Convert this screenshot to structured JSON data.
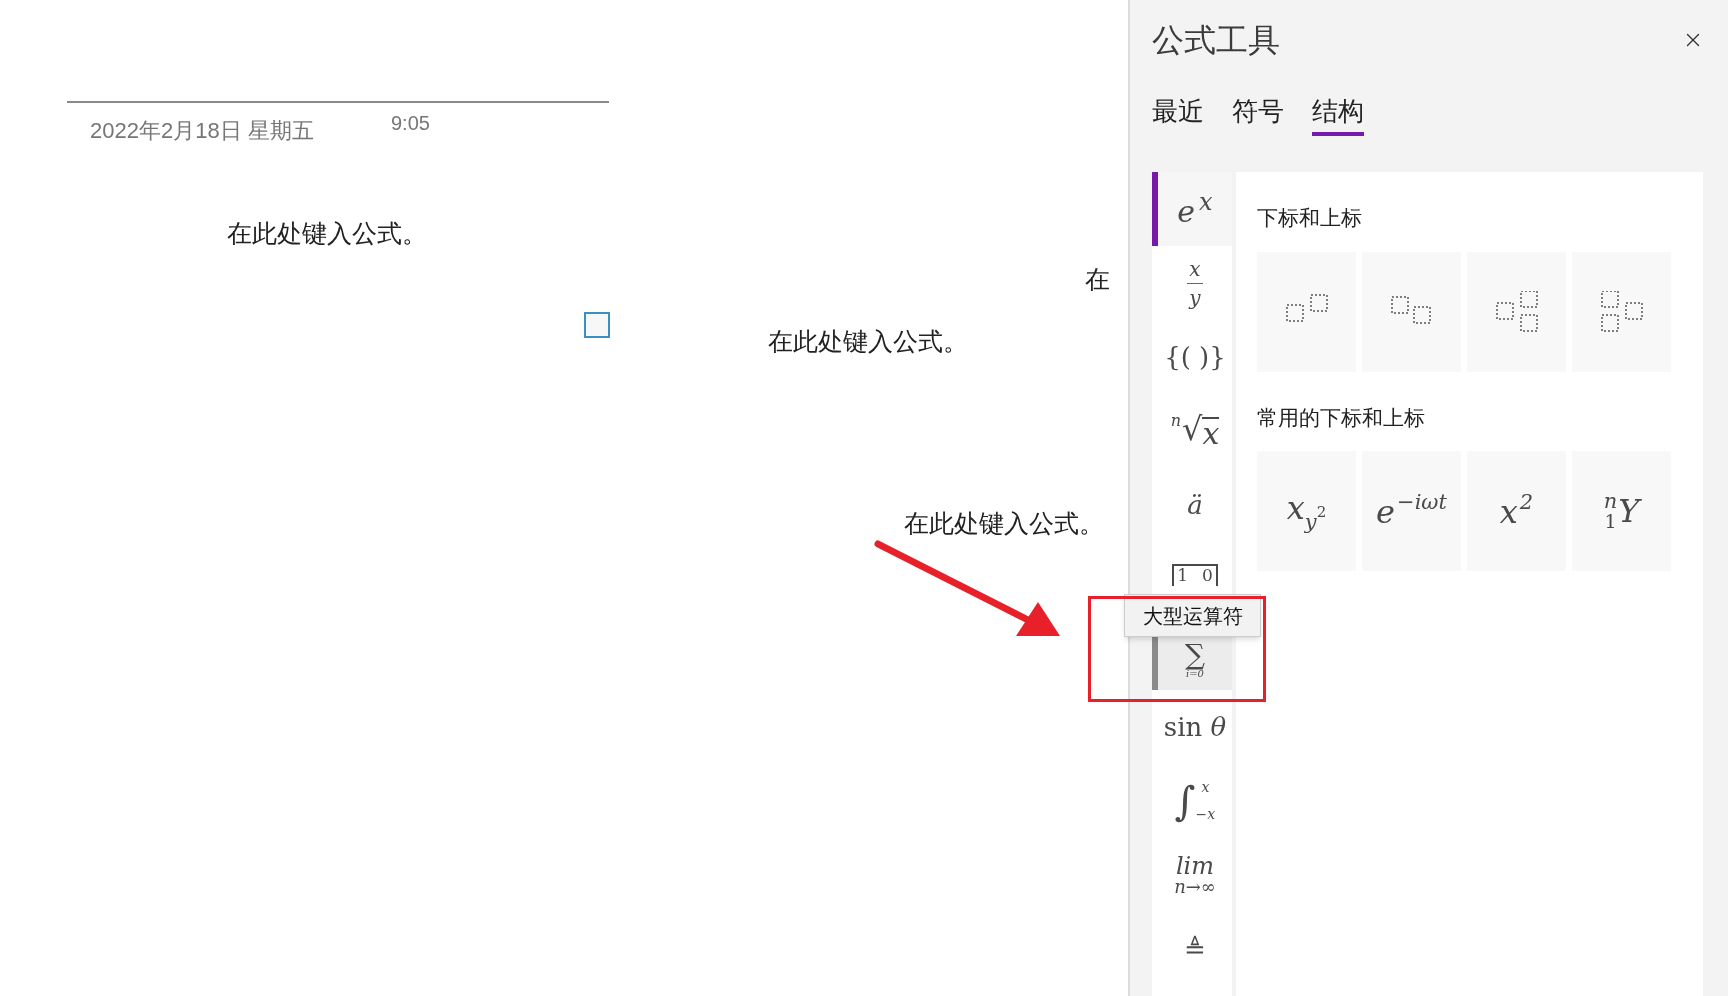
{
  "page": {
    "date": "2022年2月18日 星期五",
    "time": "9:05",
    "equations": [
      {
        "text": "在此处键入公式。"
      },
      {
        "text": "在"
      },
      {
        "text": "在此处键入公式。"
      },
      {
        "text": "在此处键入公式。"
      }
    ]
  },
  "panel": {
    "title": "公式工具",
    "tabs": [
      {
        "label": "最近",
        "selected": false
      },
      {
        "label": "符号",
        "selected": false
      },
      {
        "label": "结构",
        "selected": true
      }
    ],
    "categories": [
      {
        "kind": "script",
        "base": "e",
        "sup": "x",
        "selected": true,
        "hovered": false
      },
      {
        "kind": "fraction",
        "num": "x",
        "den": "y",
        "selected": false,
        "hovered": false
      },
      {
        "kind": "text",
        "text": "{( )}",
        "selected": false,
        "hovered": false
      },
      {
        "kind": "radical",
        "index": "n",
        "symbol": "√",
        "radicand": "x",
        "selected": false,
        "hovered": false
      },
      {
        "kind": "text",
        "text": "*ä*",
        "selected": false,
        "hovered": false
      },
      {
        "kind": "matrix",
        "cells": [
          "1",
          "0"
        ],
        "selected": false,
        "hovered": false
      },
      {
        "kind": "operator",
        "symbol": "∑",
        "lower": "i=0",
        "selected": false,
        "hovered": true,
        "tooltip": "大型运算符"
      },
      {
        "kind": "text",
        "text": "sin *θ*",
        "selected": false,
        "hovered": false
      },
      {
        "kind": "integral",
        "symbol": "∫",
        "upper": "x",
        "lower": "−x",
        "selected": false,
        "hovered": false
      },
      {
        "kind": "limit",
        "top": "lim",
        "bottom": "n→∞",
        "selected": false,
        "hovered": false
      },
      {
        "kind": "text",
        "text": "≜",
        "selected": false,
        "hovered": false
      }
    ],
    "sections": [
      {
        "heading": "下标和上标",
        "tiles": [
          {
            "kind": "sup"
          },
          {
            "kind": "sub"
          },
          {
            "kind": "subsup"
          },
          {
            "kind": "presubsup"
          }
        ]
      },
      {
        "heading": "常用的下标和上标",
        "tiles": [
          {
            "kind": "formula",
            "parts": [
              {
                "kind": "base",
                "text": "x"
              },
              {
                "kind": "sub",
                "text": "y"
              },
              {
                "kind": "subsup",
                "text": "2"
              }
            ]
          },
          {
            "kind": "formula",
            "parts": [
              {
                "kind": "base",
                "text": "e"
              },
              {
                "kind": "sup",
                "text": "−iωt"
              }
            ]
          },
          {
            "kind": "formula",
            "parts": [
              {
                "kind": "base",
                "text": "x"
              },
              {
                "kind": "sup",
                "text": "2"
              }
            ]
          },
          {
            "kind": "formula",
            "parts": [
              {
                "kind": "presup",
                "text": "n"
              },
              {
                "kind": "presub",
                "text": "1"
              },
              {
                "kind": "base",
                "text": "Y"
              }
            ]
          }
        ]
      }
    ]
  }
}
